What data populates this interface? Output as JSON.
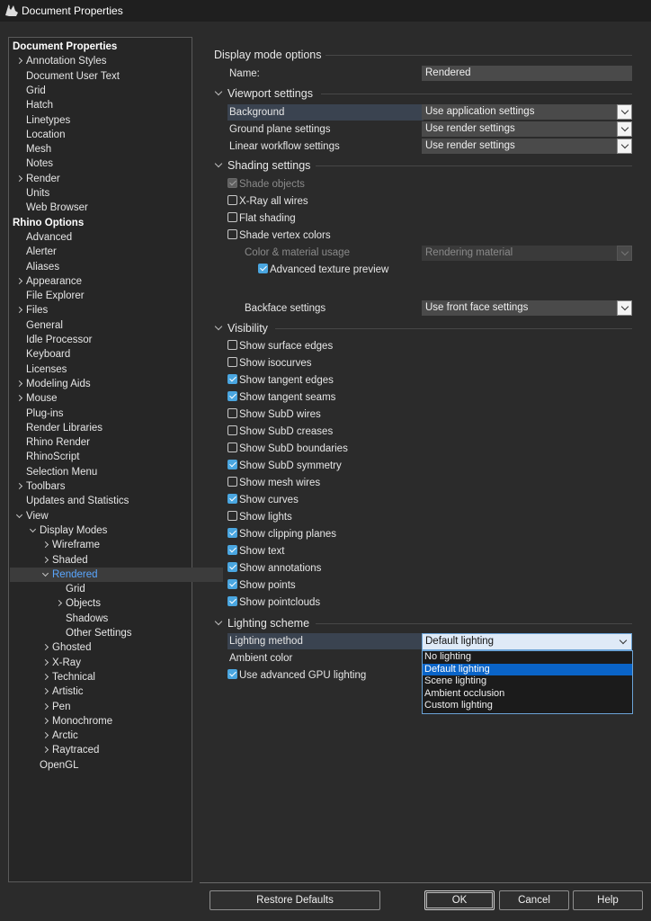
{
  "window": {
    "title": "Document Properties"
  },
  "tree": {
    "items": [
      {
        "label": "Document Properties",
        "bold": true,
        "indent": 0,
        "chevron": "none"
      },
      {
        "label": "Annotation Styles",
        "indent": 1,
        "chevron": "closed"
      },
      {
        "label": "Document User Text",
        "indent": 1,
        "chevron": "none"
      },
      {
        "label": "Grid",
        "indent": 1,
        "chevron": "none"
      },
      {
        "label": "Hatch",
        "indent": 1,
        "chevron": "none"
      },
      {
        "label": "Linetypes",
        "indent": 1,
        "chevron": "none"
      },
      {
        "label": "Location",
        "indent": 1,
        "chevron": "none"
      },
      {
        "label": "Mesh",
        "indent": 1,
        "chevron": "none"
      },
      {
        "label": "Notes",
        "indent": 1,
        "chevron": "none"
      },
      {
        "label": "Render",
        "indent": 1,
        "chevron": "closed"
      },
      {
        "label": "Units",
        "indent": 1,
        "chevron": "none"
      },
      {
        "label": "Web Browser",
        "indent": 1,
        "chevron": "none"
      },
      {
        "label": "Rhino Options",
        "bold": true,
        "indent": 0,
        "chevron": "none"
      },
      {
        "label": "Advanced",
        "indent": 1,
        "chevron": "none"
      },
      {
        "label": "Alerter",
        "indent": 1,
        "chevron": "none"
      },
      {
        "label": "Aliases",
        "indent": 1,
        "chevron": "none"
      },
      {
        "label": "Appearance",
        "indent": 1,
        "chevron": "closed"
      },
      {
        "label": "File Explorer",
        "indent": 1,
        "chevron": "none"
      },
      {
        "label": "Files",
        "indent": 1,
        "chevron": "closed"
      },
      {
        "label": "General",
        "indent": 1,
        "chevron": "none"
      },
      {
        "label": "Idle Processor",
        "indent": 1,
        "chevron": "none"
      },
      {
        "label": "Keyboard",
        "indent": 1,
        "chevron": "none"
      },
      {
        "label": "Licenses",
        "indent": 1,
        "chevron": "none"
      },
      {
        "label": "Modeling Aids",
        "indent": 1,
        "chevron": "closed"
      },
      {
        "label": "Mouse",
        "indent": 1,
        "chevron": "closed"
      },
      {
        "label": "Plug-ins",
        "indent": 1,
        "chevron": "none"
      },
      {
        "label": "Render Libraries",
        "indent": 1,
        "chevron": "none"
      },
      {
        "label": "Rhino Render",
        "indent": 1,
        "chevron": "none"
      },
      {
        "label": "RhinoScript",
        "indent": 1,
        "chevron": "none"
      },
      {
        "label": "Selection Menu",
        "indent": 1,
        "chevron": "none"
      },
      {
        "label": "Toolbars",
        "indent": 1,
        "chevron": "closed"
      },
      {
        "label": "Updates and Statistics",
        "indent": 1,
        "chevron": "none"
      },
      {
        "label": "View",
        "indent": 1,
        "chevron": "open"
      },
      {
        "label": "Display Modes",
        "indent": 2,
        "chevron": "open"
      },
      {
        "label": "Wireframe",
        "indent": 3,
        "chevron": "closed"
      },
      {
        "label": "Shaded",
        "indent": 3,
        "chevron": "closed"
      },
      {
        "label": "Rendered",
        "indent": 3,
        "chevron": "open",
        "selected": true
      },
      {
        "label": "Grid",
        "indent": 4,
        "chevron": "none"
      },
      {
        "label": "Objects",
        "indent": 4,
        "chevron": "closed"
      },
      {
        "label": "Shadows",
        "indent": 4,
        "chevron": "none"
      },
      {
        "label": "Other Settings",
        "indent": 4,
        "chevron": "none"
      },
      {
        "label": "Ghosted",
        "indent": 3,
        "chevron": "closed"
      },
      {
        "label": "X-Ray",
        "indent": 3,
        "chevron": "closed"
      },
      {
        "label": "Technical",
        "indent": 3,
        "chevron": "closed"
      },
      {
        "label": "Artistic",
        "indent": 3,
        "chevron": "closed"
      },
      {
        "label": "Pen",
        "indent": 3,
        "chevron": "closed"
      },
      {
        "label": "Monochrome",
        "indent": 3,
        "chevron": "closed"
      },
      {
        "label": "Arctic",
        "indent": 3,
        "chevron": "closed"
      },
      {
        "label": "Raytraced",
        "indent": 3,
        "chevron": "closed"
      },
      {
        "label": "OpenGL",
        "indent": 2,
        "chevron": "none"
      }
    ]
  },
  "display_mode": {
    "heading": "Display mode options",
    "name_label": "Name:",
    "name_value": "Rendered"
  },
  "viewport": {
    "heading": "Viewport settings",
    "background_label": "Background",
    "background_value": "Use application settings",
    "ground_label": "Ground plane settings",
    "ground_value": "Use render settings",
    "linear_label": "Linear workflow settings",
    "linear_value": "Use render settings"
  },
  "shading": {
    "heading": "Shading settings",
    "shade_objects": "Shade objects",
    "xray": "X-Ray all wires",
    "flat": "Flat shading",
    "vertex_colors": "Shade vertex colors",
    "color_usage_label": "Color & material usage",
    "color_usage_value": "Rendering material",
    "adv_texture": "Advanced texture preview",
    "backface_label": "Backface settings",
    "backface_value": "Use front face settings"
  },
  "visibility": {
    "heading": "Visibility",
    "items": [
      {
        "label": "Show surface edges",
        "checked": false
      },
      {
        "label": "Show isocurves",
        "checked": false
      },
      {
        "label": "Show tangent edges",
        "checked": true
      },
      {
        "label": "Show tangent seams",
        "checked": true
      },
      {
        "label": "Show SubD wires",
        "checked": false
      },
      {
        "label": "Show SubD creases",
        "checked": false
      },
      {
        "label": "Show SubD boundaries",
        "checked": false
      },
      {
        "label": "Show SubD symmetry",
        "checked": true
      },
      {
        "label": "Show mesh wires",
        "checked": false
      },
      {
        "label": "Show curves",
        "checked": true
      },
      {
        "label": "Show lights",
        "checked": false
      },
      {
        "label": "Show clipping planes",
        "checked": true
      },
      {
        "label": "Show text",
        "checked": true
      },
      {
        "label": "Show annotations",
        "checked": true
      },
      {
        "label": "Show points",
        "checked": true
      },
      {
        "label": "Show pointclouds",
        "checked": true
      }
    ]
  },
  "lighting": {
    "heading": "Lighting scheme",
    "method_label": "Lighting method",
    "method_value": "Default lighting",
    "ambient_label": "Ambient color",
    "gpu_label": "Use advanced GPU lighting",
    "options": [
      "No lighting",
      "Default lighting",
      "Scene lighting",
      "Ambient occlusion",
      "Custom lighting"
    ],
    "selected_option": "Default lighting"
  },
  "buttons": {
    "restore": "Restore Defaults",
    "ok": "OK",
    "cancel": "Cancel",
    "help": "Help"
  }
}
